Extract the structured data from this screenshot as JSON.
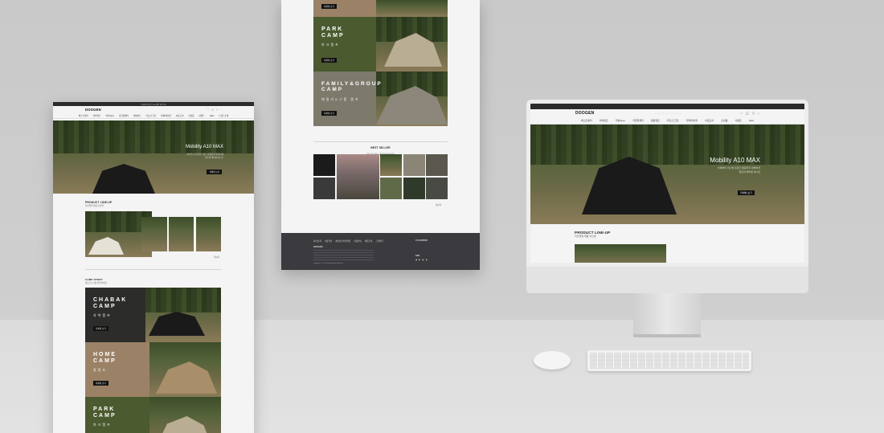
{
  "brand": {
    "logo": "DOOGEN"
  },
  "nav": [
    "베스트셀러",
    "차박텐트",
    "카본Spec",
    "자립형쉘터",
    "캠핑텐트",
    "타프/스크린",
    "카페/테이블",
    "아웃도어",
    "신상품",
    "이벤트",
    "Q&A",
    "브랜드소개"
  ],
  "hero": {
    "title": "Mobility A10 MAX",
    "line1": "차박부터 미니멀 트렁크 캠핑까지 완벽하게",
    "line2": "텐트와 쉘터를 하나로",
    "button": "자세히 보기"
  },
  "product_lineup": {
    "title": "PRODUCT LINE-UP",
    "subtitle": "라인업별 제품 라인업",
    "more": "더보기"
  },
  "camp_story": {
    "title": "CAMP STORY",
    "subtitle": "캠프스토리를 확인하세요",
    "items": [
      {
        "title": "CHABAK\nCAMP",
        "kr": "차박캠프",
        "button": "자세히 보기"
      },
      {
        "title": "HOME\nCAMP",
        "kr": "홈캠프",
        "button": "자세히 보기"
      },
      {
        "title": "PARK\nCAMP",
        "kr": "파크캠프",
        "button": "자세히 보기"
      },
      {
        "title": "FAMILY&GROUP\nCAMP",
        "kr": "패밀리&그룹 캠프",
        "button": "자세히 보기"
      }
    ]
  },
  "best_seller": {
    "title": "BEST SELLER",
    "subtitle": "가장 인기 있는 제품을 확인하세요",
    "more": "더보기"
  },
  "footer": {
    "links": [
      "회사소개",
      "이용약관",
      "개인정보처리방침",
      "이용안내",
      "제휴문의",
      "고객센터"
    ],
    "company": "DOOGEN",
    "cs_label": "CS CENTER",
    "sns_label": "SNS",
    "copyright": "Copyright © DOOGEN All rights reserved."
  },
  "top_banner": "신규회원 가입 시 10% 할인 쿠폰 지급"
}
